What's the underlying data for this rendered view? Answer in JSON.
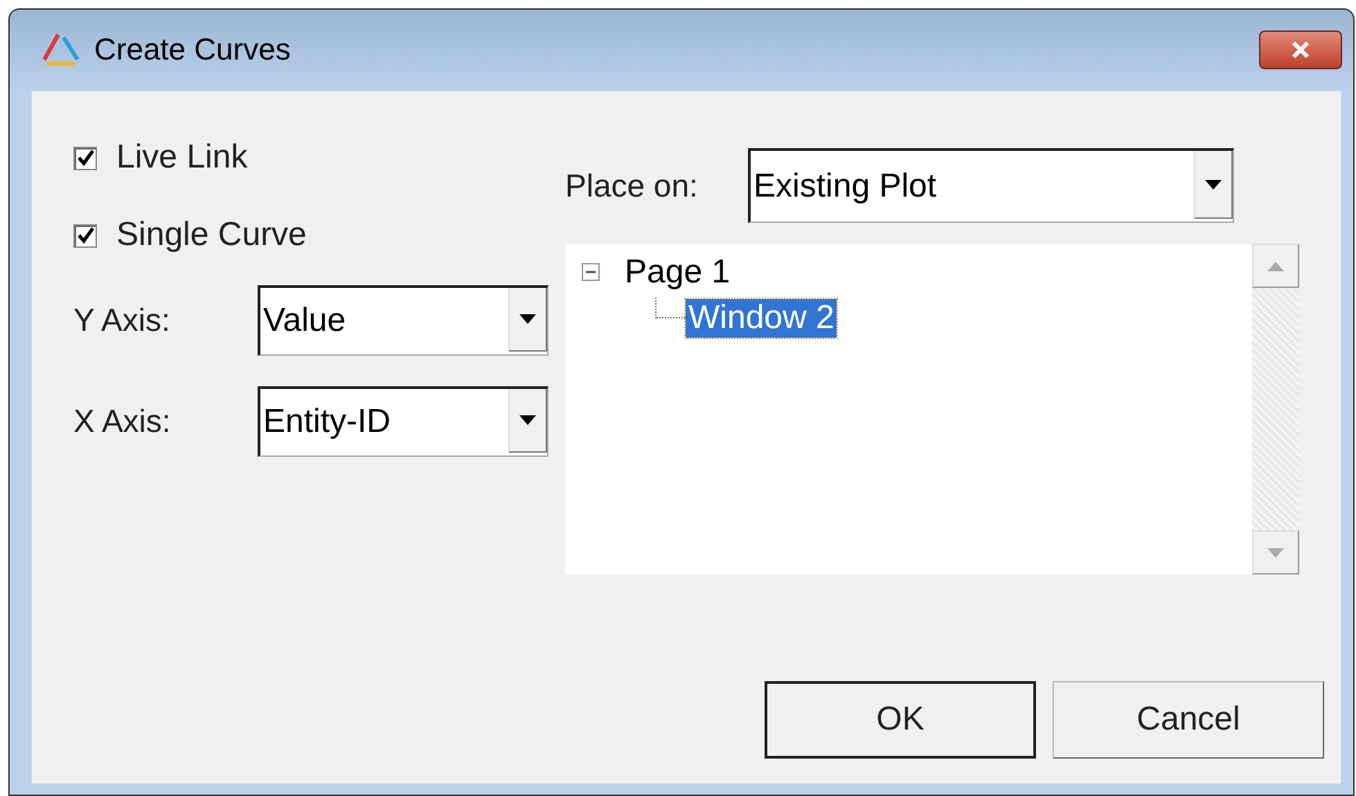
{
  "window": {
    "title": "Create Curves"
  },
  "checkboxes": [
    {
      "label": "Live Link",
      "checked": true
    },
    {
      "label": "Single Curve",
      "checked": true
    }
  ],
  "axes": [
    {
      "label": "Y Axis:",
      "value": "Value"
    },
    {
      "label": "X Axis:",
      "value": "Entity-ID"
    }
  ],
  "place_on": {
    "label": "Place on:",
    "value": "Existing Plot"
  },
  "tree": [
    {
      "label": "Page 1",
      "expanded": true,
      "selected": false,
      "children": [
        {
          "label": "Window 2",
          "selected": true
        }
      ]
    }
  ],
  "buttons": [
    "OK",
    "Cancel"
  ]
}
